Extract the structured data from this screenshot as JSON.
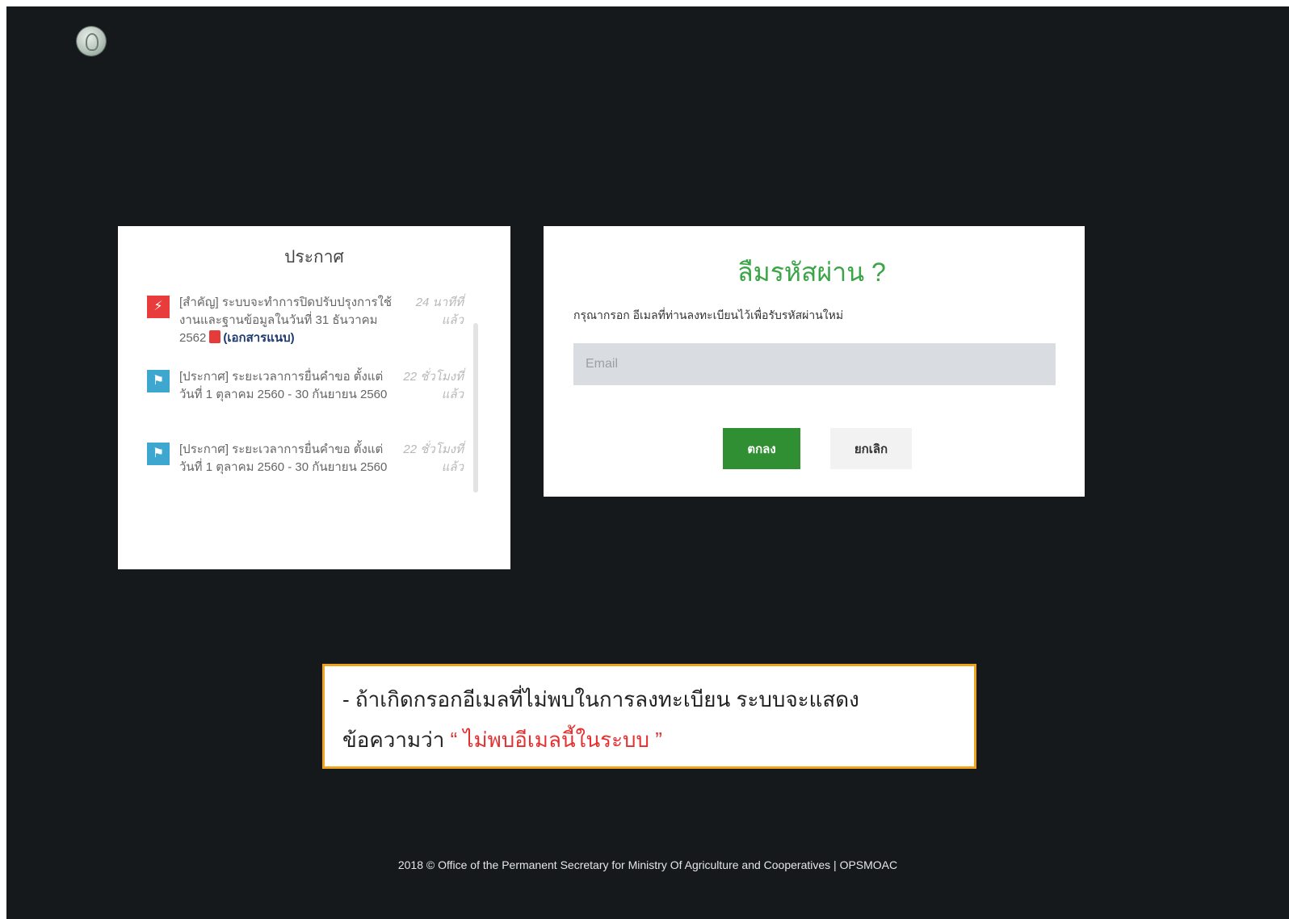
{
  "announcements": {
    "title": "ประกาศ",
    "items": [
      {
        "icon": "lightning-icon",
        "text": "[สำคัญ] ระบบจะทำการปิดปรับปรุงการใช้งานและฐานข้อมูลในวันที่ 31 ธันวาคม 2562",
        "attachment": "(เอกสารแนบ)",
        "time": "24 นาทีที่แล้ว"
      },
      {
        "icon": "megaphone-icon",
        "text": "[ประกาศ] ระยะเวลาการยื่นคำขอ ตั้งแต่ วันที่ 1 ตุลาคม 2560 - 30 กันยายน 2560",
        "time": "22 ชั่วโมงที่แล้ว"
      },
      {
        "icon": "megaphone-icon",
        "text": "[ประกาศ] ระยะเวลาการยื่นคำขอ ตั้งแต่ วันที่ 1 ตุลาคม 2560 - 30 กันยายน 2560",
        "time": "22 ชั่วโมงที่แล้ว"
      }
    ]
  },
  "forgot": {
    "title": "ลืมรหัสผ่าน ?",
    "instruction": "กรุณากรอก อีเมลที่ท่านลงทะเบียนไว้เพื่อรับรหัสผ่านใหม่",
    "email_placeholder": "Email",
    "email_value": "",
    "ok_label": "ตกลง",
    "cancel_label": "ยกเลิก"
  },
  "note": {
    "line1": "- ถ้าเกิดกรอกอีเมลที่ไม่พบในการลงทะเบียน ระบบจะแสดง",
    "line2_prefix": "ข้อความว่า",
    "line2_error": "“ ไม่พบอีเมลนี้ในระบบ ”"
  },
  "footer": {
    "text": "2018 © Office of the Permanent Secretary for Ministry Of Agriculture and Cooperatives  |  OPSMOAC"
  },
  "colors": {
    "background": "#15191c",
    "accent_green": "#3aa546",
    "ok_button": "#2f8f32",
    "note_border": "#f0a41e",
    "error_text": "#e62f2f"
  }
}
